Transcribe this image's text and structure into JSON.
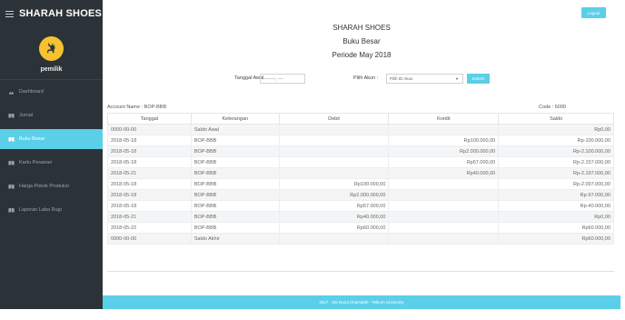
{
  "app": {
    "title": "SHARAH SHOES"
  },
  "profile": {
    "name": "pemilik"
  },
  "sidebar": {
    "items": [
      {
        "label": "Dashboard",
        "icon": "dashboard-icon",
        "active": false
      },
      {
        "label": "Jurnal",
        "icon": "book-icon",
        "active": false
      },
      {
        "label": "Buku Besar",
        "icon": "book-icon",
        "active": true
      },
      {
        "label": "Kartu Pesanan",
        "icon": "book-icon",
        "active": false
      },
      {
        "label": "Harga Pokok Produksi",
        "icon": "book-icon",
        "active": false
      },
      {
        "label": "Laporan Laba Rugi",
        "icon": "book-icon",
        "active": false
      }
    ]
  },
  "header": {
    "logout_label": "Logout",
    "company": "SHARAH SHOES",
    "report_title": "Buku Besar",
    "period": "Periode May 2018"
  },
  "filter": {
    "start_date_label": "Tanggal Awal",
    "start_date_placeholder": "---------, ----",
    "account_label": "Pilih Akun :",
    "account_value": "Pilih ID Akun",
    "submit_label": "Submit"
  },
  "account": {
    "name": "Account Name : BOP-BBB",
    "code": "Code : 6000"
  },
  "table": {
    "headers": [
      "Tanggal",
      "Keterangan",
      "Debit",
      "Kredit",
      "Saldo"
    ],
    "rows": [
      [
        "0000-00-00",
        "Saldo Awal",
        "",
        "",
        "Rp0,00"
      ],
      [
        "2018-05-18",
        "BOP-BBB",
        "",
        "Rp100.000,00",
        "Rp-100.000,00"
      ],
      [
        "2018-05-18",
        "BOP-BBB",
        "",
        "Rp2.000.000,00",
        "Rp-2.100.000,00"
      ],
      [
        "2018-05-18",
        "BOP-BBB",
        "",
        "Rp57.000,00",
        "Rp-2.157.000,00"
      ],
      [
        "2018-05-21",
        "BOP-BBB",
        "",
        "Rp40.000,00",
        "Rp-2.197.000,00"
      ],
      [
        "2018-05-18",
        "BOP-BBB",
        "Rp100.000,00",
        "",
        "Rp-2.097.000,00"
      ],
      [
        "2018-05-18",
        "BOP-BBB",
        "Rp2.000.000,00",
        "",
        "Rp-97.000,00"
      ],
      [
        "2018-05-18",
        "BOP-BBB",
        "Rp57.000,00",
        "",
        "Rp-40.000,00"
      ],
      [
        "2018-05-21",
        "BOP-BBB",
        "Rp40.000,00",
        "",
        "Rp0,00"
      ],
      [
        "2018-05-22",
        "BOP-BBB",
        "Rp60.000,00",
        "",
        "Rp60.000,00"
      ],
      [
        "0000-00-00",
        "Saldo Akhir",
        "",
        "",
        "Rp60.000,00"
      ]
    ]
  },
  "footer": {
    "text": "2017 - Siti Nurul Chamidah - Telkom University"
  },
  "colors": {
    "sidebar": "#2c3338",
    "accent": "#5bcfe8",
    "avatar": "#f6c22f"
  }
}
